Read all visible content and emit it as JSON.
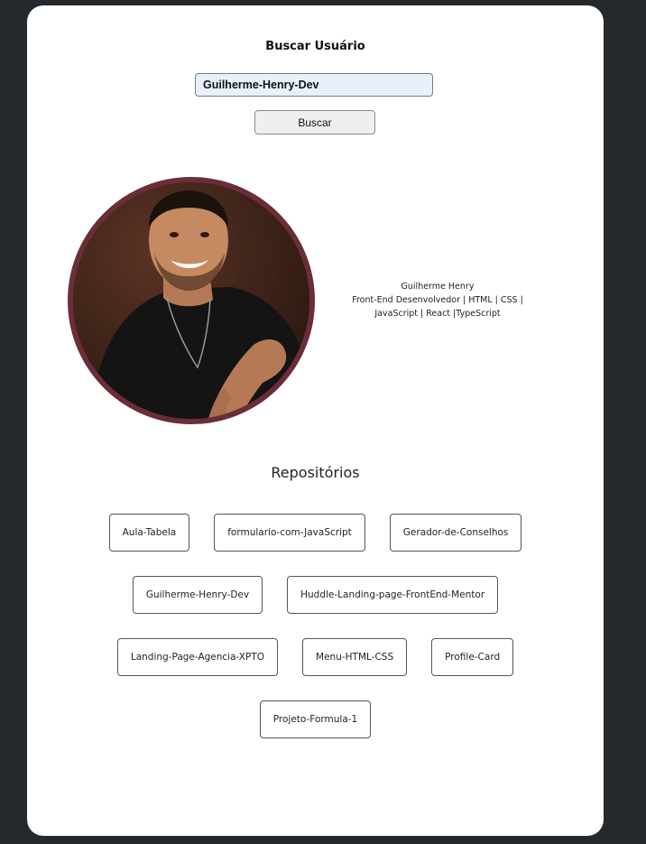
{
  "search": {
    "title": "Buscar Usuário",
    "input_value": "Guilherme-Henry-Dev",
    "button_label": "Buscar"
  },
  "profile": {
    "name": "Guilherme Henry",
    "bio_line1": "Front-End Desenvolvedor | HTML | CSS |",
    "bio_line2": "JavaScript | React |TypeScript"
  },
  "repositories": {
    "title": "Repositórios",
    "rows": [
      [
        "Aula-Tabela",
        "formulario-com-JavaScript",
        "Gerador-de-Conselhos"
      ],
      [
        "Guilherme-Henry-Dev",
        "Huddle-Landing-page-FrontEnd-Mentor"
      ],
      [
        "Landing-Page-Agencia-XPTO",
        "Menu-HTML-CSS",
        "Profile-Card"
      ],
      [
        "Projeto-Formula-1"
      ]
    ]
  },
  "colors": {
    "page_background": "#24292e",
    "card_background": "#ffffff",
    "avatar_border": "#6b2d38",
    "input_background": "#e8f0fe"
  }
}
